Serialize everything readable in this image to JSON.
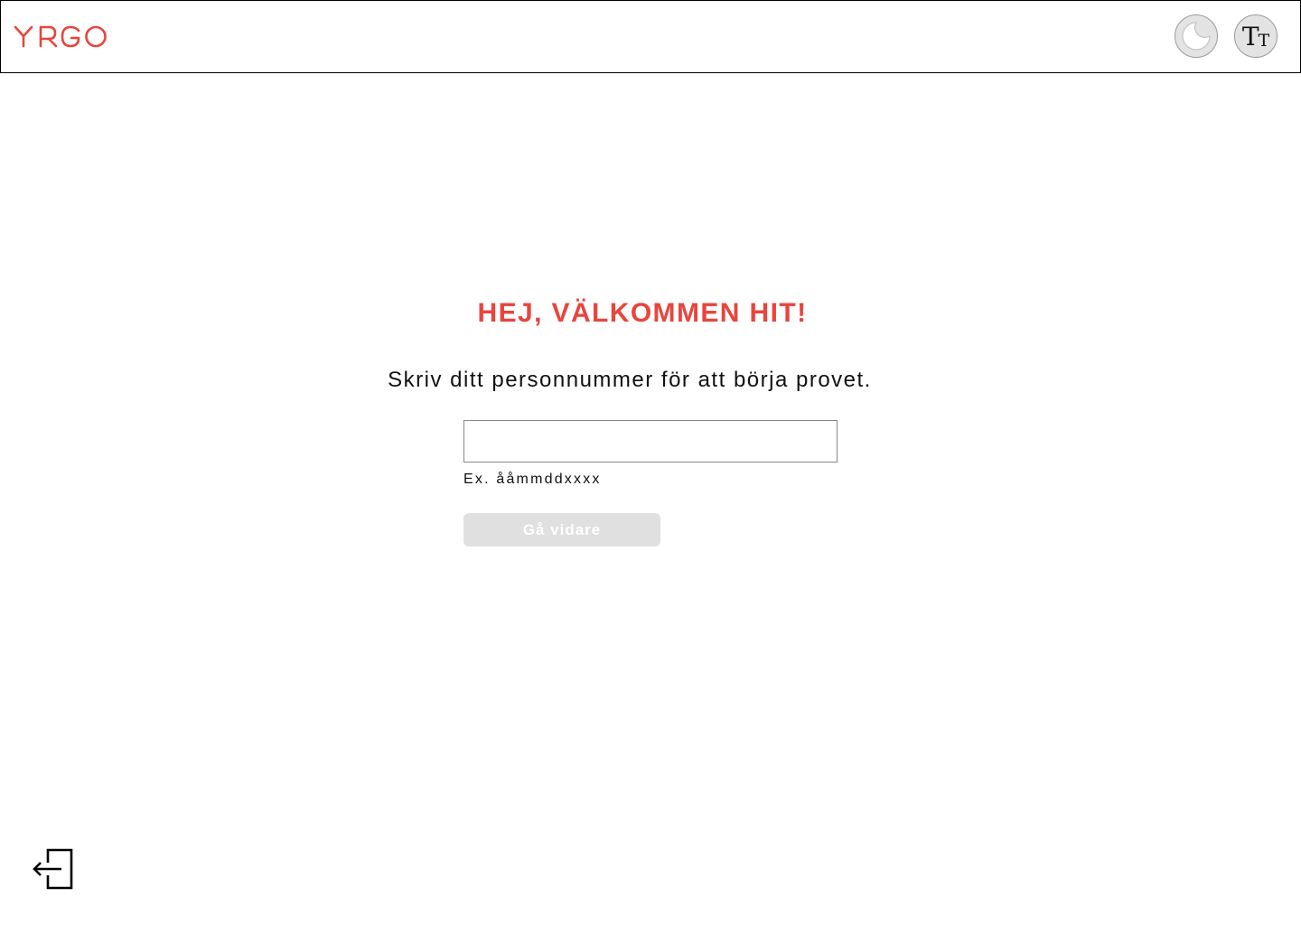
{
  "header": {
    "logo_text": "YRGO",
    "brand_color": "#e8453c",
    "dark_mode_button": {
      "icon": "moon-icon"
    },
    "text_size_button": {
      "icon": "text-size-icon",
      "glyph_large": "T",
      "glyph_small": "T"
    }
  },
  "main": {
    "title": "HEJ, VÄLKOMMEN HIT!",
    "subtitle": "Skriv ditt personnummer för att börja provet.",
    "personnummer_input": {
      "value": "",
      "placeholder": ""
    },
    "hint": "Ex. ååmmddxxxx",
    "next_button_label": "Gå vidare",
    "next_button_disabled": true
  },
  "footer": {
    "logout_icon": "logout-icon"
  }
}
